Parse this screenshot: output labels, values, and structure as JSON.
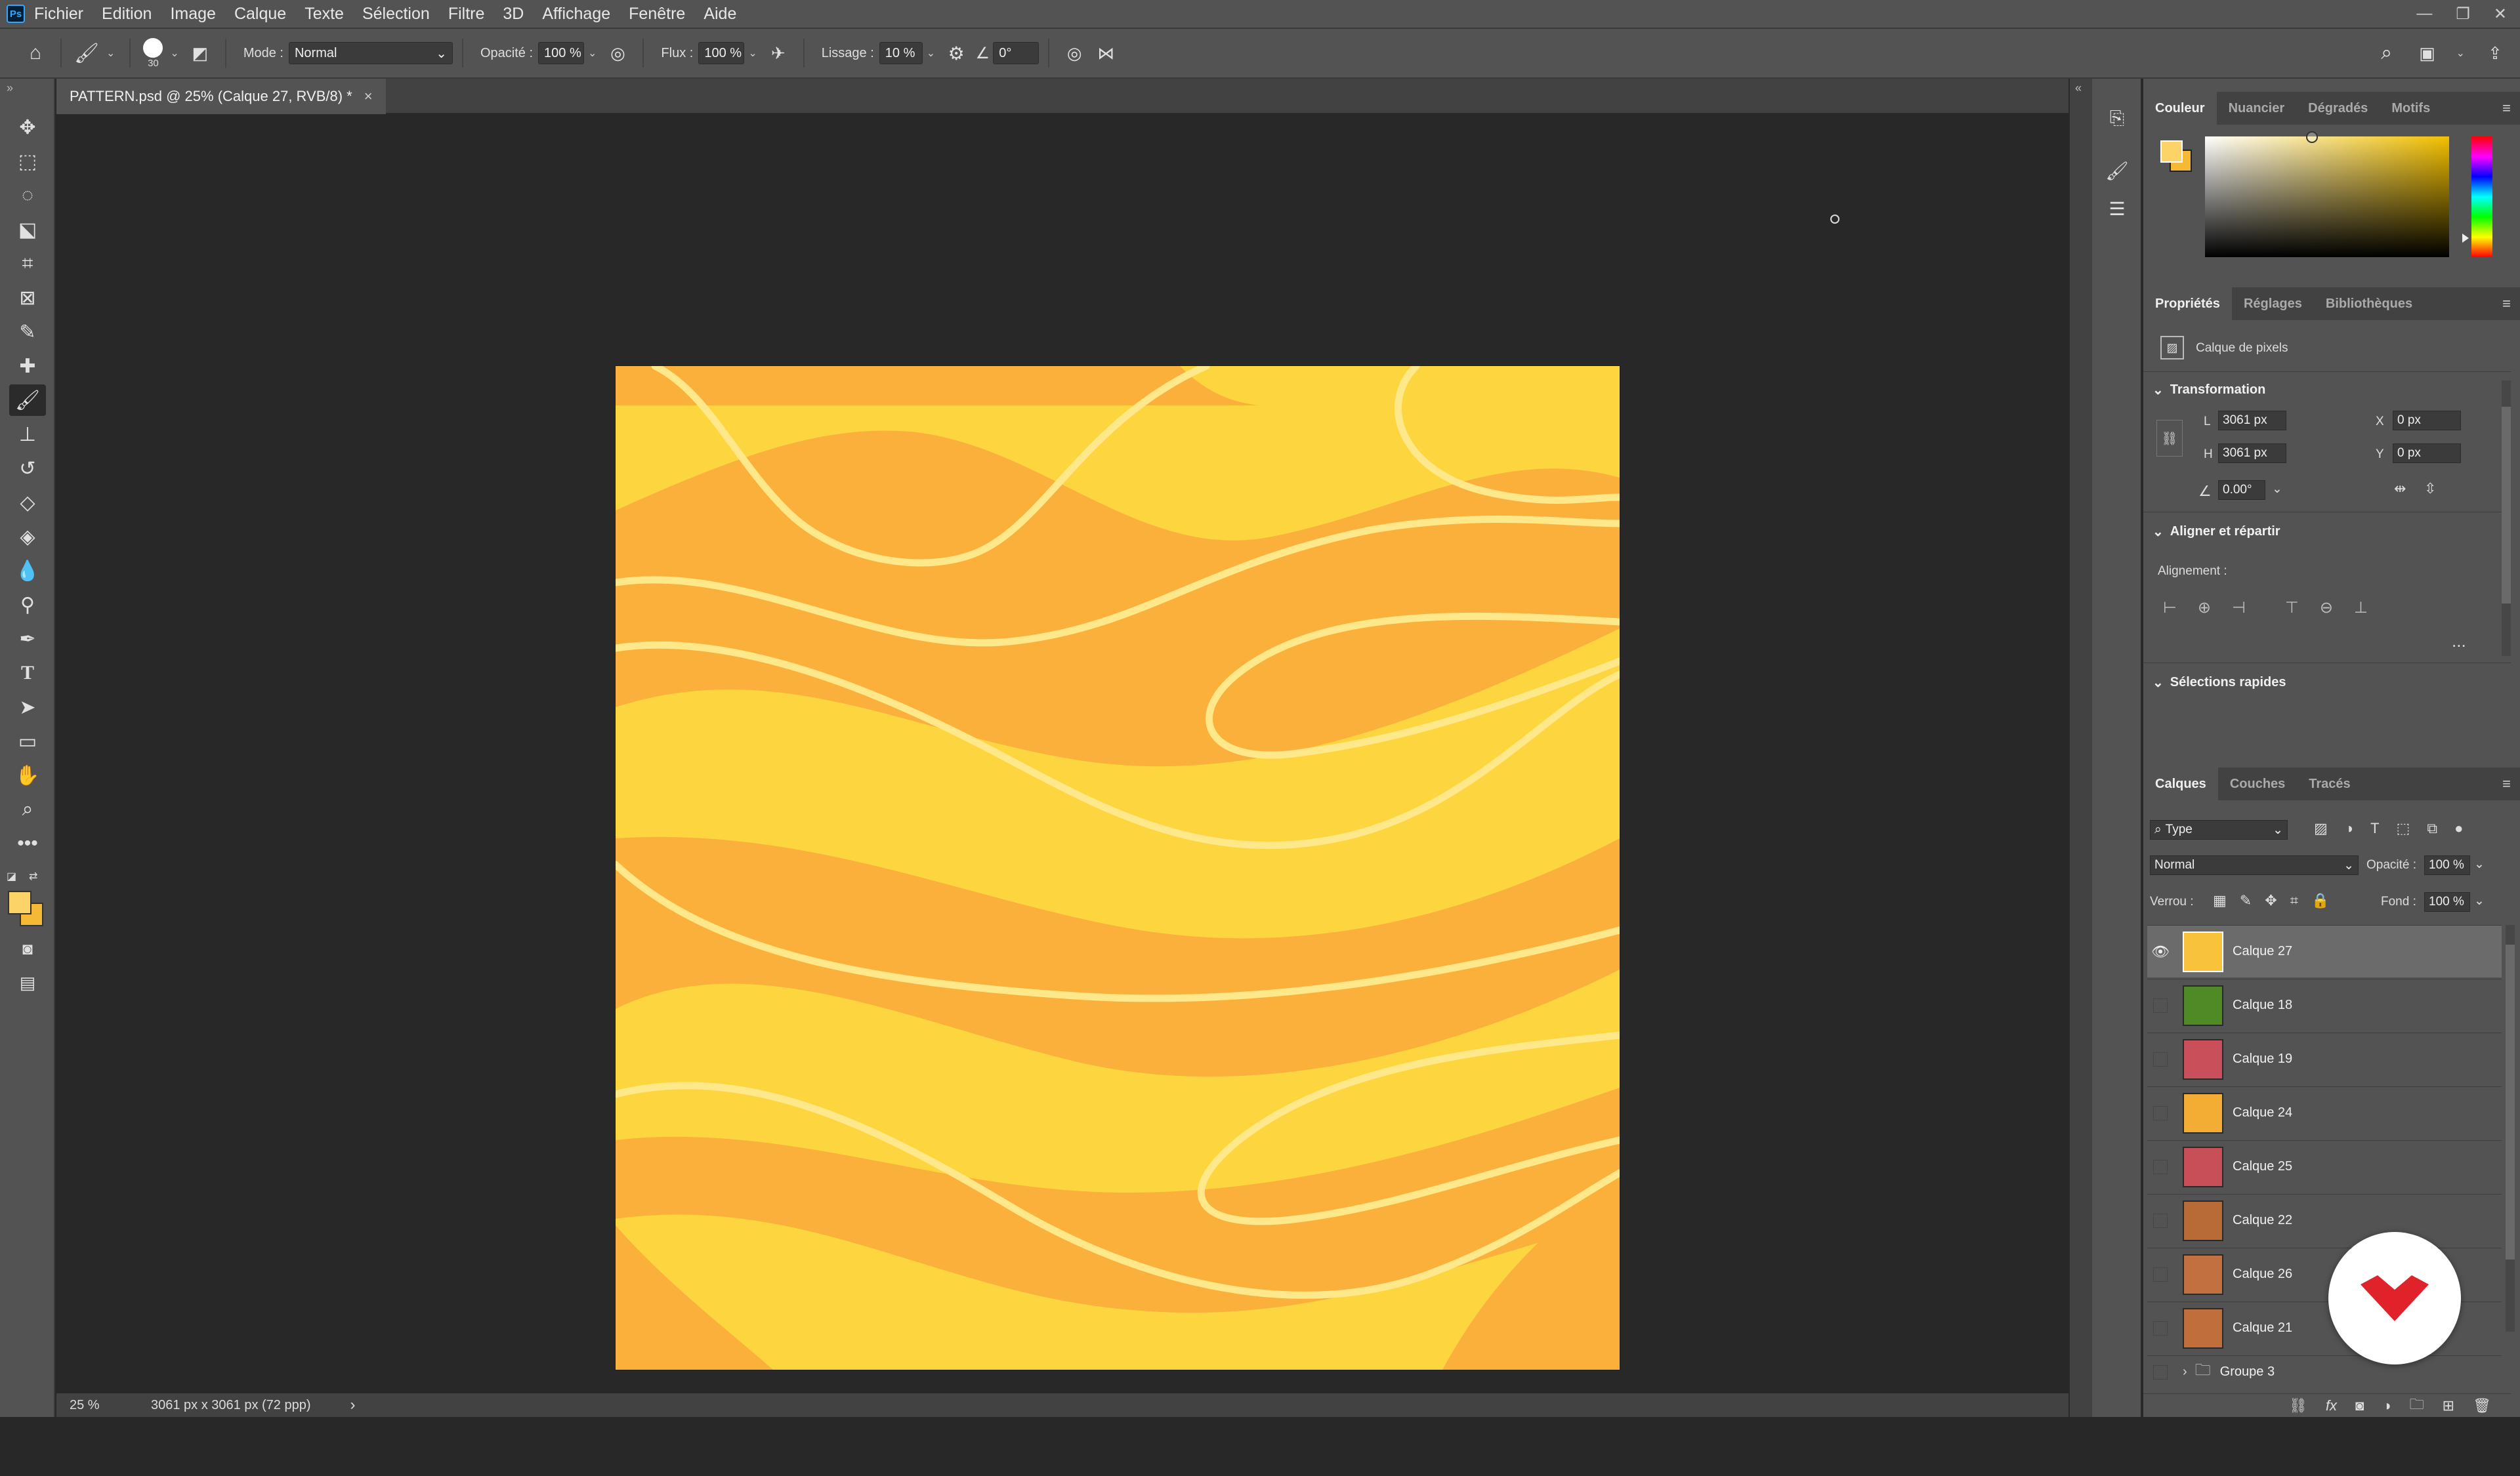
{
  "menubar": {
    "app_icon": "Ps",
    "items": [
      "Fichier",
      "Edition",
      "Image",
      "Calque",
      "Texte",
      "Sélection",
      "Filtre",
      "3D",
      "Affichage",
      "Fenêtre",
      "Aide"
    ]
  },
  "options": {
    "brush_size": "30",
    "mode_label": "Mode :",
    "mode_value": "Normal",
    "opacity_label": "Opacité :",
    "opacity_value": "100 %",
    "flow_label": "Flux :",
    "flow_value": "100 %",
    "smoothing_label": "Lissage :",
    "smoothing_value": "10 %",
    "angle_value": "0°"
  },
  "document": {
    "tab_title": "PATTERN.psd @ 25% (Calque 27, RVB/8) *",
    "close_glyph": "×"
  },
  "status": {
    "zoom": "25 %",
    "doc_size": "3061 px x 3061 px (72 ppp)",
    "arrow": "›"
  },
  "color_panel": {
    "tabs": [
      "Couleur",
      "Nuancier",
      "Dégradés",
      "Motifs"
    ],
    "foreground": "#fcd367",
    "background": "#f5b936"
  },
  "properties_panel": {
    "tabs": [
      "Propriétés",
      "Réglages",
      "Bibliothèques"
    ],
    "layer_kind": "Calque de pixels",
    "transform_header": "Transformation",
    "w_label": "L",
    "w_value": "3061 px",
    "h_label": "H",
    "h_value": "3061 px",
    "x_label": "X",
    "x_value": "0 px",
    "y_label": "Y",
    "y_value": "0 px",
    "angle_value": "0.00°",
    "align_header": "Aligner et répartir",
    "align_label": "Alignement :",
    "quick_header": "Sélections rapides",
    "more": "..."
  },
  "layers_panel": {
    "tabs": [
      "Calques",
      "Couches",
      "Tracés"
    ],
    "filter_value": "Type",
    "blend_mode": "Normal",
    "opacity_label": "Opacité :",
    "opacity_value": "100 %",
    "lock_label": "Verrou :",
    "fill_label": "Fond :",
    "fill_value": "100 %",
    "layers": [
      {
        "name": "Calque 27",
        "visible": true,
        "selected": true,
        "thumb": "#f8c33a"
      },
      {
        "name": "Calque 18",
        "visible": false,
        "selected": false,
        "thumb": "#4f8a24"
      },
      {
        "name": "Calque 19",
        "visible": false,
        "selected": false,
        "thumb": "#c9505a"
      },
      {
        "name": "Calque 24",
        "visible": false,
        "selected": false,
        "thumb": "#f4ad34"
      },
      {
        "name": "Calque 25",
        "visible": false,
        "selected": false,
        "thumb": "#c84e58"
      },
      {
        "name": "Calque 22",
        "visible": false,
        "selected": false,
        "thumb": "#b86a37"
      },
      {
        "name": "Calque 26",
        "visible": false,
        "selected": false,
        "thumb": "#c27040"
      },
      {
        "name": "Calque 21",
        "visible": false,
        "selected": false,
        "thumb": "#c06e3c"
      }
    ],
    "group_name": "Groupe 3"
  },
  "colors": {
    "art_orange": "#fbb03b",
    "art_yellow": "#fdd63f",
    "art_stroke": "#ffe88a",
    "brand_red": "#e0222a"
  }
}
